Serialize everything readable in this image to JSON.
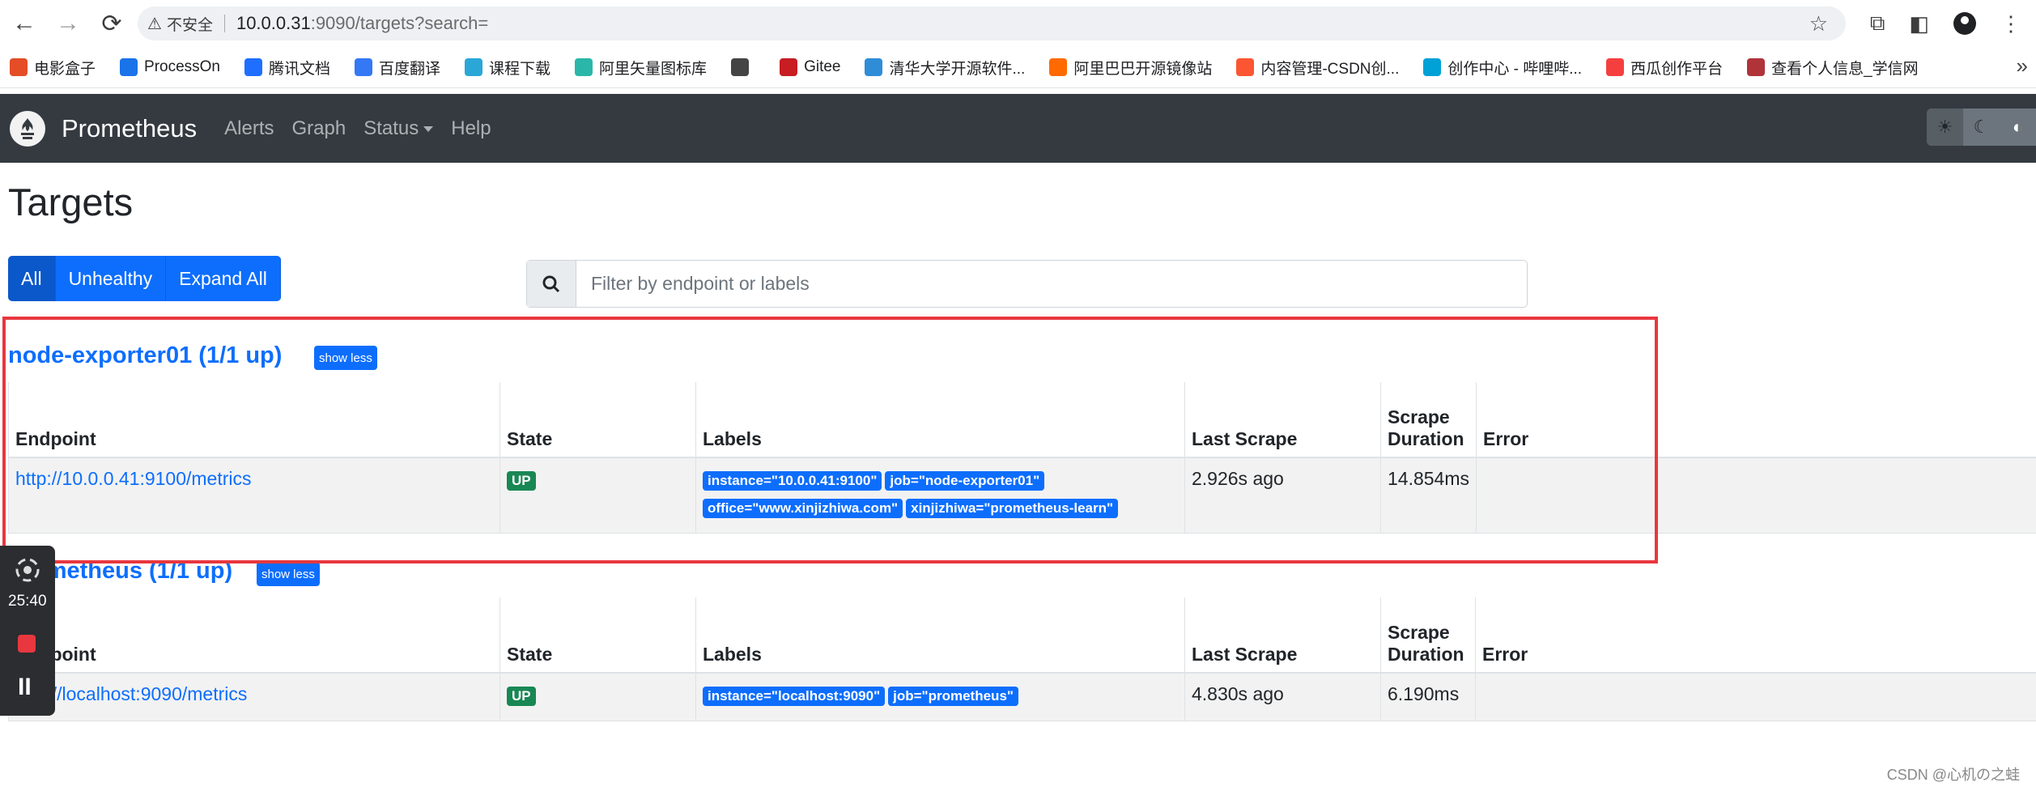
{
  "browser": {
    "security_label": "不安全",
    "url_host": "10.0.0.31",
    "url_rest": ":9090/targets?search=",
    "bookmarks": [
      {
        "label": "电影盒子",
        "color": "#e44d26",
        "icon": "film-icon"
      },
      {
        "label": "ProcessOn",
        "color": "#1a73e8",
        "icon": "processon-icon"
      },
      {
        "label": "腾讯文档",
        "color": "#1e6fff",
        "icon": "tencent-docs-icon"
      },
      {
        "label": "百度翻译",
        "color": "#3478f6",
        "icon": "baidu-translate-icon"
      },
      {
        "label": "课程下载",
        "color": "#2aa7d7",
        "icon": "course-icon"
      },
      {
        "label": "阿里矢量图标库",
        "color": "#2ab7a9",
        "icon": "iconfont-icon"
      },
      {
        "label": "",
        "color": "#444444",
        "icon": "globe-icon"
      },
      {
        "label": "Gitee",
        "color": "#c71d23",
        "icon": "gitee-icon"
      },
      {
        "label": "清华大学开源软件...",
        "color": "#2f8dd8",
        "icon": "tuna-icon"
      },
      {
        "label": "阿里巴巴开源镜像站",
        "color": "#ff6a00",
        "icon": "aliyun-icon"
      },
      {
        "label": "内容管理-CSDN创...",
        "color": "#fc5531",
        "icon": "csdn-icon"
      },
      {
        "label": "创作中心 - 哔哩哔...",
        "color": "#00a1d6",
        "icon": "bilibili-icon"
      },
      {
        "label": "西瓜创作平台",
        "color": "#f53f3f",
        "icon": "xigua-icon"
      },
      {
        "label": "查看个人信息_学信网",
        "color": "#b0333a",
        "icon": "chsi-icon"
      }
    ]
  },
  "navbar": {
    "brand": "Prometheus",
    "links": [
      "Alerts",
      "Graph",
      "Status",
      "Help"
    ]
  },
  "page": {
    "title": "Targets",
    "filters": [
      "All",
      "Unhealthy",
      "Expand All"
    ],
    "search_placeholder": "Filter by endpoint or labels"
  },
  "columns": [
    "Endpoint",
    "State",
    "Labels",
    "Last Scrape",
    "Scrape Duration",
    "Error"
  ],
  "columns_scrape_duration_lines": [
    "Scrape",
    "Duration"
  ],
  "jobs": [
    {
      "title": "node-exporter01 (1/1 up)",
      "toggle": "show less",
      "rows": [
        {
          "endpoint": "http://10.0.0.41:9100/metrics",
          "state": "UP",
          "labels": [
            "instance=\"10.0.0.41:9100\"",
            "job=\"node-exporter01\"",
            "office=\"www.xinjizhiwa.com\"",
            "xinjizhiwa=\"prometheus-learn\""
          ],
          "last_scrape": "2.926s ago",
          "duration": "14.854ms",
          "error": ""
        }
      ]
    },
    {
      "title": "prometheus (1/1 up)",
      "toggle": "show less",
      "rows": [
        {
          "endpoint": "http://localhost:9090/metrics",
          "state": "UP",
          "labels": [
            "instance=\"localhost:9090\"",
            "job=\"prometheus\""
          ],
          "last_scrape": "4.830s ago",
          "duration": "6.190ms",
          "error": ""
        }
      ]
    }
  ],
  "recorder": {
    "time": "25:40"
  },
  "watermark": "CSDN @心机の之蛙",
  "colors": {
    "accent": "#0d6efd",
    "navbar": "#343a40",
    "up": "#198754",
    "highlight": "#e8373e"
  }
}
